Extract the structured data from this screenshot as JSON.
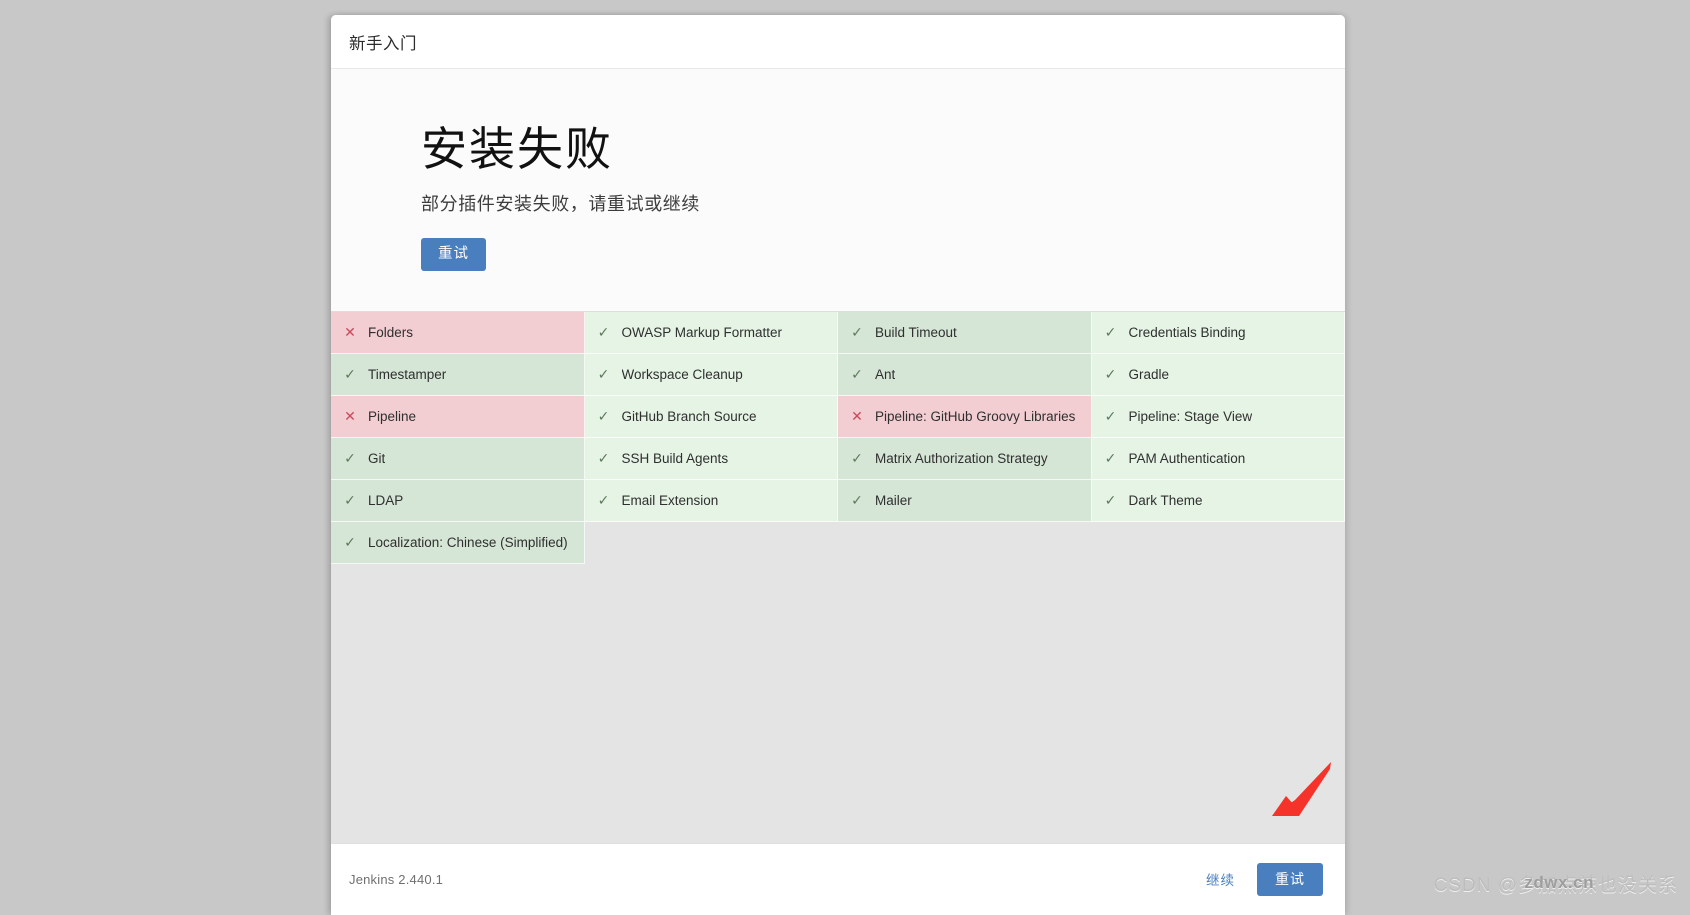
{
  "window": {
    "header_title": "新手入门"
  },
  "hero": {
    "title": "安装失败",
    "subtitle": "部分插件安装失败，请重试或继续",
    "retry_label": "重试"
  },
  "colors": {
    "accent_blue": "#4a7fbf",
    "success_bg_dark": "#d6e6d6",
    "success_bg_light": "#e5f4e5",
    "fail_bg_dark": "#f2cdd2",
    "fail_bg_light": "#f7d5d9",
    "page_bg": "#c8c8c8",
    "body_bg": "#e4e4e4",
    "arrow_red": "#f5332a"
  },
  "icons": {
    "success": "✓",
    "failure": "✕"
  },
  "plugins": {
    "columns": 4,
    "rows": [
      [
        {
          "name": "Folders",
          "status": "fail",
          "icon": "x-icon"
        },
        {
          "name": "OWASP Markup Formatter",
          "status": "ok",
          "icon": "check-icon"
        },
        {
          "name": "Build Timeout",
          "status": "ok",
          "icon": "check-icon"
        },
        {
          "name": "Credentials Binding",
          "status": "ok",
          "icon": "check-icon"
        }
      ],
      [
        {
          "name": "Timestamper",
          "status": "ok",
          "icon": "check-icon"
        },
        {
          "name": "Workspace Cleanup",
          "status": "ok",
          "icon": "check-icon"
        },
        {
          "name": "Ant",
          "status": "ok",
          "icon": "check-icon"
        },
        {
          "name": "Gradle",
          "status": "ok",
          "icon": "check-icon"
        }
      ],
      [
        {
          "name": "Pipeline",
          "status": "fail",
          "icon": "x-icon"
        },
        {
          "name": "GitHub Branch Source",
          "status": "ok",
          "icon": "check-icon"
        },
        {
          "name": "Pipeline: GitHub Groovy Libraries",
          "status": "fail",
          "icon": "x-icon"
        },
        {
          "name": "Pipeline: Stage View",
          "status": "ok",
          "icon": "check-icon"
        }
      ],
      [
        {
          "name": "Git",
          "status": "ok",
          "icon": "check-icon"
        },
        {
          "name": "SSH Build Agents",
          "status": "ok",
          "icon": "check-icon"
        },
        {
          "name": "Matrix Authorization Strategy",
          "status": "ok",
          "icon": "check-icon"
        },
        {
          "name": "PAM Authentication",
          "status": "ok",
          "icon": "check-icon"
        }
      ],
      [
        {
          "name": "LDAP",
          "status": "ok",
          "icon": "check-icon"
        },
        {
          "name": "Email Extension",
          "status": "ok",
          "icon": "check-icon"
        },
        {
          "name": "Mailer",
          "status": "ok",
          "icon": "check-icon"
        },
        {
          "name": "Dark Theme",
          "status": "ok",
          "icon": "check-icon"
        }
      ],
      [
        {
          "name": "Localization: Chinese (Simplified)",
          "status": "ok",
          "icon": "check-icon"
        },
        {
          "name": "",
          "status": "empty",
          "icon": ""
        },
        {
          "name": "",
          "status": "empty",
          "icon": ""
        },
        {
          "name": "",
          "status": "empty",
          "icon": ""
        }
      ]
    ]
  },
  "footer": {
    "version": "Jenkins 2.440.1",
    "continue_label": "继续",
    "retry_label": "重试"
  },
  "watermarks": {
    "csdn": "CSDN @多加点辣也没关系",
    "site": "zdwx.cn"
  }
}
